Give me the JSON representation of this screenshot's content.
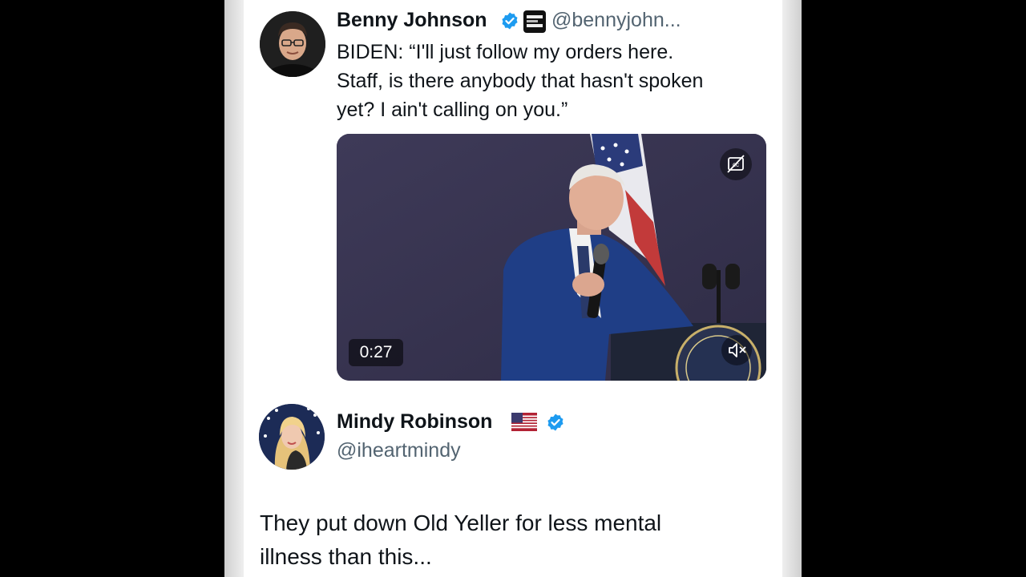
{
  "tweet1": {
    "author_name": "Benny Johnson",
    "handle": "@bennyjohn...",
    "text_lines": [
      "BIDEN: “I'll just follow my orders here.",
      "Staff, is there anybody that hasn't spoken",
      "yet? I ain't calling on you.”"
    ],
    "video": {
      "duration": "0:27",
      "icons": [
        "captions-icon",
        "mute-icon"
      ]
    }
  },
  "tweet2": {
    "author_name": "Mindy Robinson",
    "handle": "@iheartmindy",
    "text_lines": [
      "They put down Old Yeller for less mental",
      "illness than this..."
    ]
  },
  "colors": {
    "verified_blue": "#1d9bf0",
    "text_primary": "#0f1419",
    "text_secondary": "#536471"
  }
}
